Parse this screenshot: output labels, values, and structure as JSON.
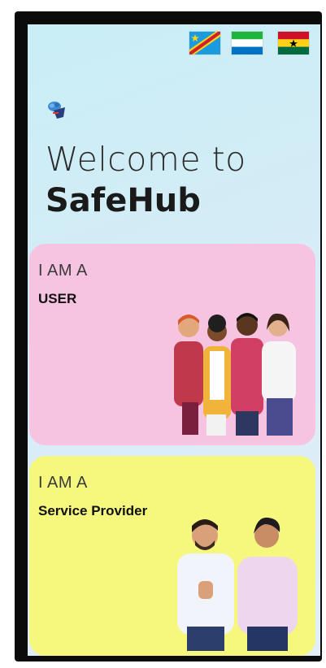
{
  "flags": [
    {
      "icon": "dr-congo-flag-icon"
    },
    {
      "icon": "sierra-leone-flag-icon"
    },
    {
      "icon": "ghana-flag-icon"
    }
  ],
  "logo": {
    "icon": "brain-logo-icon"
  },
  "header": {
    "welcome": "Welcome to",
    "app_name": "SafeHub"
  },
  "cards": [
    {
      "kicker": "I AM A",
      "title": "USER",
      "color": "#f6c4e0",
      "illustration": "group-of-people-illustration"
    },
    {
      "kicker": "I AM A",
      "title": "Service Provider",
      "color": "#f6f87e",
      "illustration": "two-people-illustration"
    }
  ]
}
